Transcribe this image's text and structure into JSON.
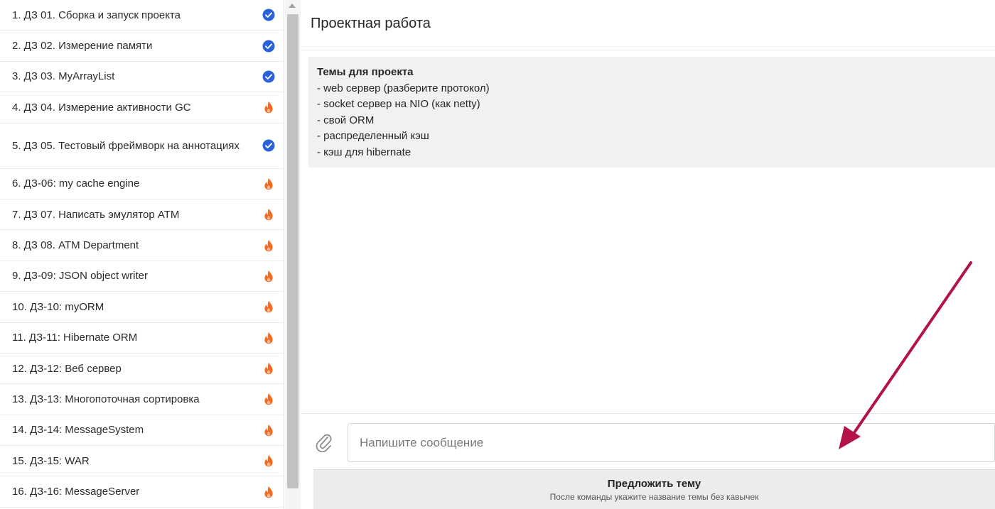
{
  "sidebar": {
    "items": [
      {
        "label": "1. ДЗ 01. Сборка и запуск проекта",
        "status": "done",
        "tall": false
      },
      {
        "label": "2. ДЗ 02. Измерение памяти",
        "status": "done",
        "tall": false
      },
      {
        "label": "3. ДЗ 03. MyArrayList",
        "status": "done",
        "tall": false
      },
      {
        "label": "4. ДЗ 04. Измерение активности GC",
        "status": "hot",
        "tall": false
      },
      {
        "label": "5. ДЗ 05. Тестовый фреймворк на аннотациях",
        "status": "done",
        "tall": true
      },
      {
        "label": "6. ДЗ-06: my cache engine",
        "status": "hot",
        "tall": false
      },
      {
        "label": "7. ДЗ 07. Написать эмулятор ATM",
        "status": "hot",
        "tall": false
      },
      {
        "label": "8. ДЗ 08. ATM Department",
        "status": "hot",
        "tall": false
      },
      {
        "label": "9. ДЗ-09: JSON object writer",
        "status": "hot",
        "tall": false
      },
      {
        "label": "10. ДЗ-10: myORM",
        "status": "hot",
        "tall": false
      },
      {
        "label": "11. ДЗ-11: Hibernate ORM",
        "status": "hot",
        "tall": false
      },
      {
        "label": "12. ДЗ-12: Веб сервер",
        "status": "hot",
        "tall": false
      },
      {
        "label": "13. ДЗ-13: Многопоточная сортировка",
        "status": "hot",
        "tall": false
      },
      {
        "label": "14. ДЗ-14: MessageSystem",
        "status": "hot",
        "tall": false
      },
      {
        "label": "15. ДЗ-15: WAR",
        "status": "hot",
        "tall": false
      },
      {
        "label": "16. ДЗ-16: MessageServer",
        "status": "hot",
        "tall": false
      }
    ]
  },
  "icons": {
    "done": "check-circle-icon",
    "hot": "flame-icon",
    "attach": "paperclip-icon",
    "scroll_up": "scroll-up-arrow-icon"
  },
  "colors": {
    "done": "#2962d9",
    "hot": "#f26b21",
    "arrow": "#b3124b"
  },
  "chat": {
    "title": "Проектная работа",
    "message": {
      "heading": "Темы для проекта",
      "lines": [
        "- web сервер (разберите протокол)",
        "- socket сервер на NIO (как netty)",
        "- свой ORM",
        "- распределенный кэш",
        "- кэш для hibernate"
      ]
    },
    "input_placeholder": "Напишите сообщение",
    "input_value": "",
    "suggest_button": {
      "label": "Предложить тему",
      "hint": "После команды укажите название темы без кавычек"
    }
  }
}
